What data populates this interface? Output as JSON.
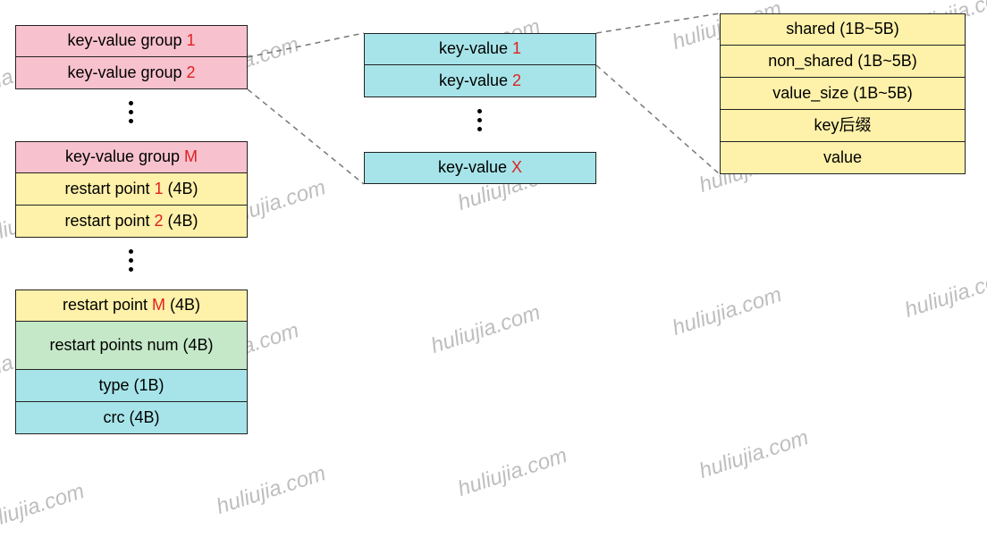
{
  "watermark": "huliujia.com",
  "left": {
    "kvg1_pre": "key-value group ",
    "kvg1_num": "1",
    "kvg2_pre": "key-value group ",
    "kvg2_num": "2",
    "kvgM_pre": "key-value group ",
    "kvgM_num": "M",
    "rp1_pre": "restart point ",
    "rp1_num": "1",
    "rp1_suf": " (4B)",
    "rp2_pre": "restart point ",
    "rp2_num": "2",
    "rp2_suf": " (4B)",
    "rpM_pre": "restart point ",
    "rpM_num": "M",
    "rpM_suf": " (4B)",
    "rpnum": "restart points num (4B)",
    "type": "type (1B)",
    "crc": "crc (4B)"
  },
  "mid": {
    "kv1_pre": "key-value ",
    "kv1_num": "1",
    "kv2_pre": "key-value ",
    "kv2_num": "2",
    "kvX_pre": "key-value ",
    "kvX_num": "X"
  },
  "right": {
    "shared": "shared (1B~5B)",
    "non_shared": "non_shared (1B~5B)",
    "value_size": "value_size (1B~5B)",
    "key_suffix": "key后缀",
    "value": "value"
  }
}
